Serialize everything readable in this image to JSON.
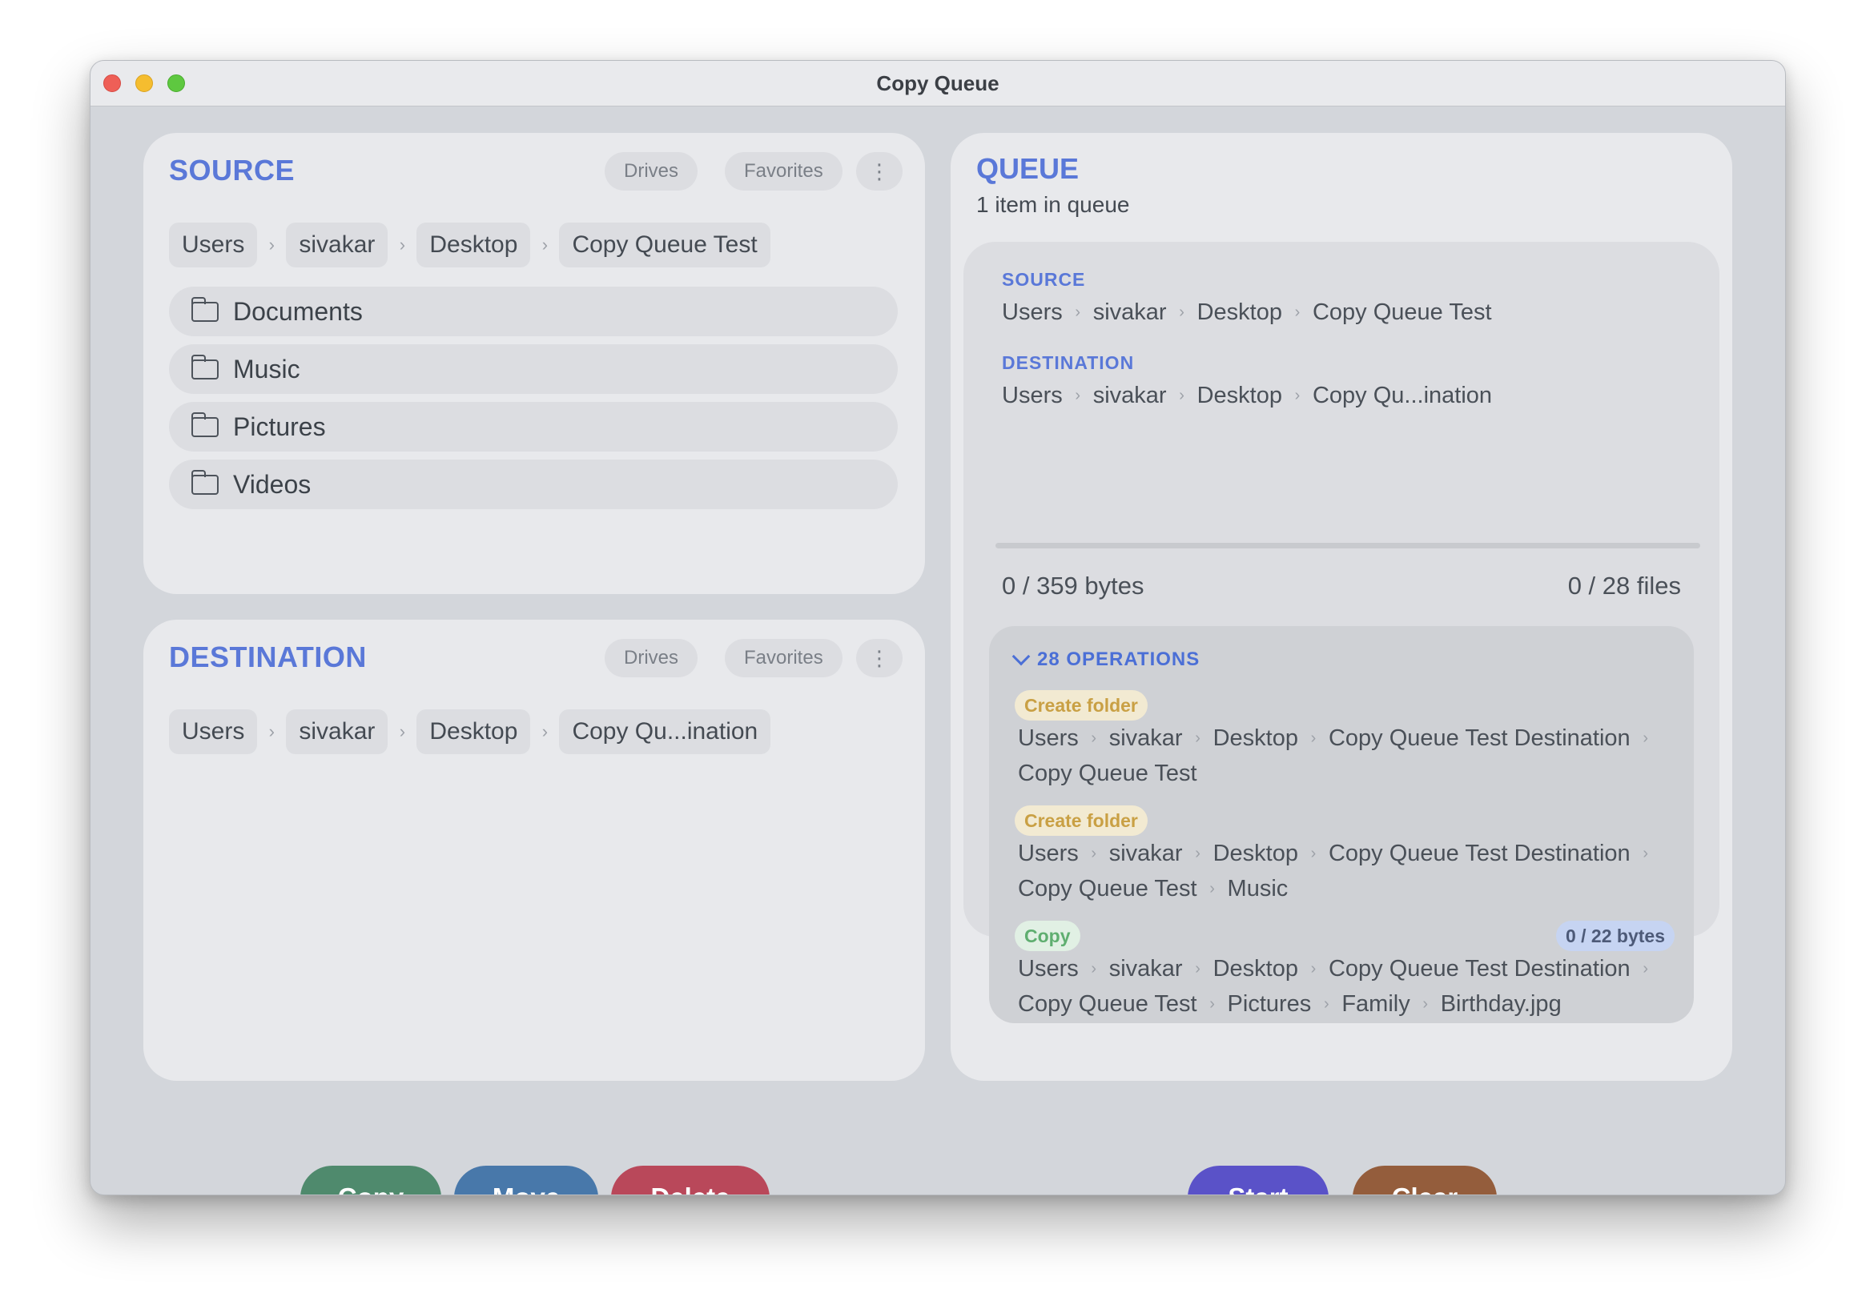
{
  "window": {
    "title": "Copy Queue"
  },
  "source": {
    "header": "SOURCE",
    "drives_label": "Drives",
    "favorites_label": "Favorites",
    "more_label": "⋮",
    "breadcrumb": [
      "Users",
      "sivakar",
      "Desktop",
      "Copy Queue Test"
    ],
    "items": [
      {
        "name": "Documents",
        "icon": "folder-icon"
      },
      {
        "name": "Music",
        "icon": "folder-icon"
      },
      {
        "name": "Pictures",
        "icon": "folder-icon"
      },
      {
        "name": "Videos",
        "icon": "folder-icon"
      }
    ]
  },
  "destination": {
    "header": "DESTINATION",
    "drives_label": "Drives",
    "favorites_label": "Favorites",
    "more_label": "⋮",
    "breadcrumb": [
      "Users",
      "sivakar",
      "Desktop",
      "Copy Qu...ination"
    ]
  },
  "actions": {
    "copy": "Copy",
    "move": "Move",
    "delete": "Delete",
    "start": "Start",
    "clear": "Clear"
  },
  "queue": {
    "header": "QUEUE",
    "count_text": "1 item in queue",
    "item": {
      "source_label": "SOURCE",
      "source_path": [
        "Users",
        "sivakar",
        "Desktop",
        "Copy Queue Test"
      ],
      "destination_label": "DESTINATION",
      "destination_path": [
        "Users",
        "sivakar",
        "Desktop",
        "Copy Qu...ination"
      ],
      "progress": 0,
      "bytes_text": "0 / 359 bytes",
      "files_text": "0 / 28 files",
      "operations_label": "28 OPERATIONS",
      "operations": [
        {
          "type": "Create folder",
          "line1": [
            "Users",
            "sivakar",
            "Desktop",
            "Copy Queue Test Destination"
          ],
          "line2": [
            "Copy Queue Test"
          ]
        },
        {
          "type": "Create folder",
          "line1": [
            "Users",
            "sivakar",
            "Desktop",
            "Copy Queue Test Destination"
          ],
          "line2": [
            "Copy Queue Test",
            "Music"
          ]
        },
        {
          "type": "Copy",
          "bytes": "0 / 22 bytes",
          "line1": [
            "Users",
            "sivakar",
            "Desktop",
            "Copy Queue Test Destination"
          ],
          "line2": [
            "Copy Queue Test",
            "Pictures",
            "Family",
            "Birthday.jpg"
          ]
        }
      ]
    }
  },
  "colors": {
    "accent": "#5a78d8",
    "copy_button": "#4f8a6d",
    "move_button": "#4878aa",
    "delete_button": "#b9485a",
    "start_button": "#5a52c8",
    "clear_button": "#945d3c",
    "create_folder_badge": "#c9a044",
    "copy_badge": "#5fae70"
  }
}
